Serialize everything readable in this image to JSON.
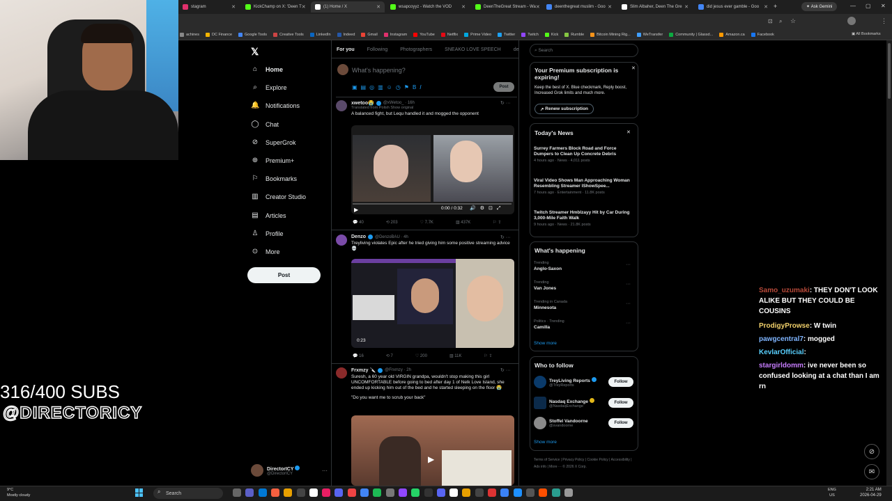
{
  "browser": {
    "tabs": [
      {
        "label": "stagram",
        "color": "#e1306c",
        "active": false
      },
      {
        "label": "KickChamp on X: 'Deen T",
        "color": "#53fc18",
        "active": false
      },
      {
        "label": "(1) Home / X",
        "color": "#ffffff",
        "active": true
      },
      {
        "label": "wsapcoyyz - Watch the VOD",
        "color": "#53fc18",
        "active": false
      },
      {
        "label": "DeenTheGreat Stream - Wa",
        "color": "#53fc18",
        "active": false
      },
      {
        "label": "deenthegreat muslim - Goo",
        "color": "#4285f4",
        "active": false
      },
      {
        "label": "Slim Albaher, Deen The Gre",
        "color": "#ffffff",
        "active": false
      },
      {
        "label": "did jesus ever gamble - Goo",
        "color": "#4285f4",
        "active": false
      }
    ],
    "ask_gemini": "Ask Gemini",
    "bookmarks": [
      "achines",
      "DC Finance",
      "Google Tools",
      "Creative Tools",
      "LinkedIn",
      "Indeed",
      "Gmail",
      "Instagram",
      "YouTube",
      "Netflix",
      "Prime Video",
      "Twitter",
      "Twitch",
      "Kick",
      "Rumble",
      "Bitcoin Mining Rig...",
      "WeTransfer",
      "Community | Glassd...",
      "Amazon.ca",
      "Facebook"
    ],
    "all_bookmarks": "All Bookmarks"
  },
  "overlay": {
    "subs": "316/400 SUBS",
    "handle": "@DIRECTORICY"
  },
  "nav": {
    "items": [
      "Home",
      "Explore",
      "Notifications",
      "Chat",
      "SuperGrok",
      "Premium+",
      "Bookmarks",
      "Creator Studio",
      "Articles",
      "Profile",
      "More"
    ],
    "post": "Post",
    "account_name": "DirectorICY",
    "account_handle": "@DirectorICY"
  },
  "feed": {
    "tabs": [
      "For you",
      "Following",
      "Photographers",
      "SNEAKO LOVE SPEECH",
      "deml c"
    ],
    "compose_placeholder": "What's happening?",
    "compose_post": "Post",
    "posts": [
      {
        "name": "xwetoo😭",
        "meta": "@xWetoo_ · 16h",
        "sub": "Translated from Polish Show original",
        "text": "A balanced fight, but Lequ handled it and mogged the opponent",
        "video_time": "0:00 / 0:32",
        "stats": [
          "40",
          "203",
          "7.7K",
          "437K"
        ]
      },
      {
        "name": "Denzo",
        "meta": "@DenzoBAU · 4h",
        "text": "Treyliving violates Epic after he tried giving him some positive streaming advice 💀",
        "video_time": "0:23",
        "stats": [
          "16",
          "7",
          "200",
          "11K"
        ]
      },
      {
        "name": "Frxmzy 🔪",
        "meta": "@Frxmzy · 2h",
        "text": "Suresh, a 60 year old VIRGIN grandpa, wouldn't stop making this girl UNCOMFORTABLE before going to bed after day 1 of Nelk Love Island, she ended up kicking him out of the bed and he started sleeping on the floor 😭",
        "quote": "\"Do you want me to scrub your back\""
      }
    ]
  },
  "sidebar": {
    "search_placeholder": "Search",
    "premium": {
      "title": "Your Premium subscription is expiring!",
      "body": "Keep the best of X. Blue checkmark, Reply boost, Increased Grok limits and much more.",
      "button": "Renew subscription"
    },
    "news_title": "Today's News",
    "news": [
      {
        "headline": "Surrey Farmers Block Road and Force Dumpers to Clean Up Concrete Debris",
        "meta": "4 hours ago · News · 4,011 posts"
      },
      {
        "headline": "Viral Video Shows Man Approaching Woman Resembling Streamer IShowSpee...",
        "meta": "7 hours ago · Entertainment · 11.8K posts"
      },
      {
        "headline": "Twitch Streamer Hmblzayy Hit by Car During 3,000-Mile Faith Walk",
        "meta": "9 hours ago · News · 21.8K posts"
      }
    ],
    "happening_title": "What's happening",
    "trends": [
      {
        "context": "Trending",
        "name": "Anglo-Saxon"
      },
      {
        "context": "Trending",
        "name": "Van Jones"
      },
      {
        "context": "Trending in Canada",
        "name": "Minnesota"
      },
      {
        "context": "Politics · Trending",
        "name": "Camilla"
      }
    ],
    "show_more": "Show more",
    "wtf_title": "Who to follow",
    "who_to_follow": [
      {
        "name": "TreyLiving Reports",
        "handle": "@TreyReports",
        "button": "Follow"
      },
      {
        "name": "Nasdaq Exchange",
        "handle": "@NasdaqExchange",
        "button": "Follow"
      },
      {
        "name": "Stoffel Vandoorne",
        "handle": "@svandoorne",
        "button": "Follow"
      }
    ],
    "footer": "Terms of Service | Privacy Policy | Cookie Policy | Accessibility | Ads info | More ··· © 2026 X Corp."
  },
  "chat": [
    {
      "user": "Samo_uzumaki",
      "color": "#b84a3a",
      "msg": ": THEY DON'T LOOK ALIKE BUT THEY COULD BE COUSINS"
    },
    {
      "user": "ProdigyProwse",
      "color": "#f2d16b",
      "msg": ": W twin"
    },
    {
      "user": "pawgcentral7",
      "color": "#7fb5ff",
      "msg": ": mogged"
    },
    {
      "user": "KevlarOfficial",
      "color": "#59d0ff",
      "msg": ":"
    },
    {
      "user": "stargirldomm",
      "color": "#c77dff",
      "msg": ": ive never been so confused looking at a chat than I am rn"
    }
  ],
  "taskbar": {
    "weather_temp": "9°C",
    "weather_desc": "Mostly cloudy",
    "search": "Search",
    "lang1": "ENG",
    "lang2": "US",
    "time": "2:21 AM",
    "date": "2026-04-29"
  }
}
